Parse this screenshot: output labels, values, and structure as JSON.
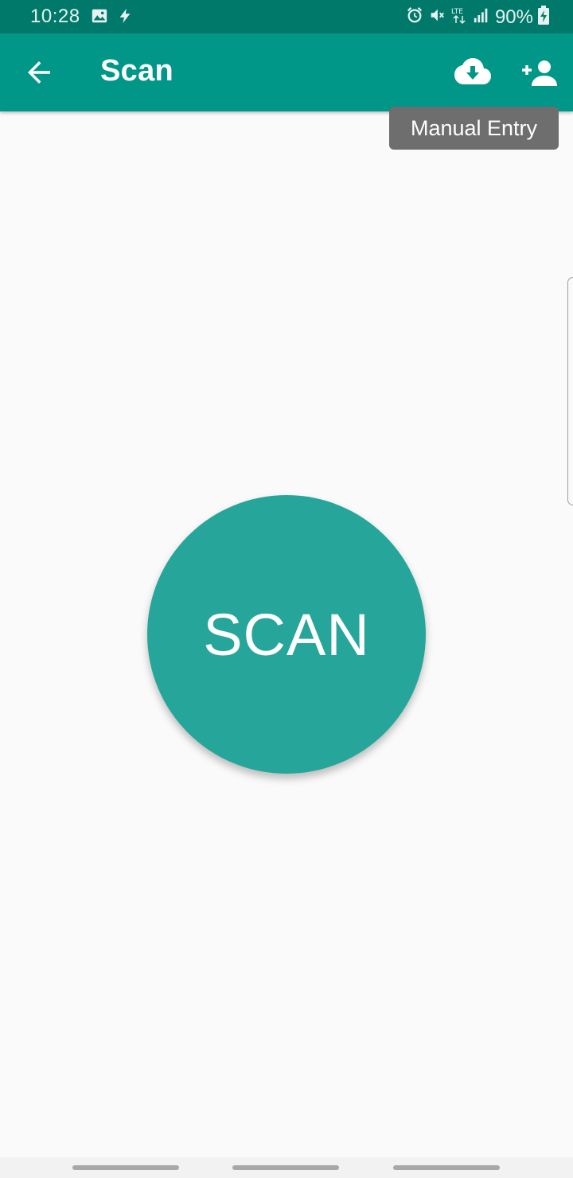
{
  "status_bar": {
    "time": "10:28",
    "battery": "90%",
    "icons": [
      "image-icon",
      "flash-icon",
      "alarm-icon",
      "mute-icon",
      "lte-icon",
      "signal-icon",
      "battery-charging-icon"
    ]
  },
  "app_bar": {
    "title": "Scan",
    "actions": [
      "cloud-download-icon",
      "add-person-icon"
    ]
  },
  "tooltip": {
    "text": "Manual Entry"
  },
  "main": {
    "scan_button_label": "SCAN"
  },
  "colors": {
    "status_bar": "#00796b",
    "app_bar": "#009688",
    "scan_button": "#26a69a",
    "tooltip": "#6e6e6e",
    "background": "#fafafa"
  }
}
